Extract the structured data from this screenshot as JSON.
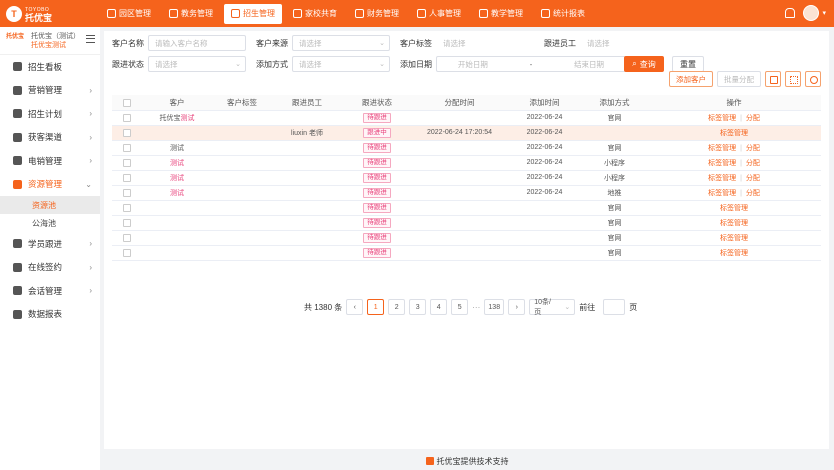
{
  "brand": {
    "en": "TOYOBO",
    "cn": "托优宝"
  },
  "nav": [
    {
      "label": "园区管理"
    },
    {
      "label": "教务管理"
    },
    {
      "label": "招生管理",
      "active": true
    },
    {
      "label": "家校共育"
    },
    {
      "label": "财务管理"
    },
    {
      "label": "人事管理"
    },
    {
      "label": "教学管理"
    },
    {
      "label": "统计报表"
    }
  ],
  "school": {
    "logo": "托优宝",
    "name": "托优宝（测试）",
    "sub": "托优宝测试"
  },
  "sidebar": [
    {
      "label": "招生看板",
      "arrow": ""
    },
    {
      "label": "营销管理",
      "arrow": "›"
    },
    {
      "label": "招生计划",
      "arrow": "›"
    },
    {
      "label": "获客渠道",
      "arrow": "›"
    },
    {
      "label": "电销管理",
      "arrow": "›"
    },
    {
      "label": "资源管理",
      "arrow": "⌄",
      "open": true
    },
    {
      "label": "学员跟进",
      "arrow": "›"
    },
    {
      "label": "在线签约",
      "arrow": "›"
    },
    {
      "label": "会话管理",
      "arrow": "›"
    },
    {
      "label": "数据报表",
      "arrow": ""
    }
  ],
  "submenu": [
    {
      "label": "资源池",
      "active": true
    },
    {
      "label": "公海池"
    }
  ],
  "filters": {
    "row1": [
      {
        "label": "客户名称",
        "placeholder": "请输入客户名称",
        "width": 0
      },
      {
        "label": "客户来源",
        "placeholder": "请选择"
      },
      {
        "label": "客户标签",
        "placeholder": "请选择"
      },
      {
        "label": "跟进员工",
        "placeholder": "请选择"
      }
    ],
    "row2": [
      {
        "label": "跟进状态",
        "placeholder": "请选择"
      },
      {
        "label": "添加方式",
        "placeholder": "请选择"
      },
      {
        "label": "添加日期",
        "start": "开始日期",
        "sep": "-",
        "end": "结束日期"
      }
    ],
    "search": "查询",
    "reset": "重置"
  },
  "toolbar": {
    "add": "添加客户",
    "batch": "批量分配"
  },
  "table": {
    "headers": [
      "",
      "客户",
      "客户标签",
      "跟进员工",
      "跟进状态",
      "分配时间",
      "添加时间",
      "添加方式",
      "操作"
    ],
    "rows": [
      {
        "customer": "托优宝",
        "customer_pink": "测试",
        "tag": "",
        "staff": "",
        "status": "待跟进",
        "assign": "",
        "added": "2022-06-24",
        "method": "官网",
        "op1": "标签管理",
        "op2": "分配"
      },
      {
        "customer": "",
        "customer_pink": "",
        "tag": "",
        "staff": "liuxin 老师",
        "status": "跟进中",
        "assign": "2022-06-24 17:20:54",
        "added": "2022-06-24",
        "method": "",
        "op1": "标签管理",
        "op2": "",
        "hl": true
      },
      {
        "customer": "测试",
        "customer_pink": "",
        "tag": "",
        "staff": "",
        "status": "待跟进",
        "assign": "",
        "added": "2022-06-24",
        "method": "官网",
        "op1": "标签管理",
        "op2": "分配"
      },
      {
        "customer": "",
        "customer_pink": "测试",
        "tag": "",
        "staff": "",
        "status": "待跟进",
        "assign": "",
        "added": "2022-06-24",
        "method": "小程序",
        "op1": "标签管理",
        "op2": "分配"
      },
      {
        "customer": "",
        "customer_pink": "测试",
        "tag": "",
        "staff": "",
        "status": "待跟进",
        "assign": "",
        "added": "2022-06-24",
        "method": "小程序",
        "op1": "标签管理",
        "op2": "分配"
      },
      {
        "customer": "",
        "customer_pink": "测试",
        "tag": "",
        "staff": "",
        "status": "待跟进",
        "assign": "",
        "added": "2022-06-24",
        "method": "地推",
        "op1": "标签管理",
        "op2": "分配"
      },
      {
        "customer": "",
        "customer_pink": "",
        "tag": "",
        "staff": "",
        "status": "待跟进",
        "assign": "",
        "added": "",
        "method": "官网",
        "op1": "标签管理",
        "op2": ""
      },
      {
        "customer": "",
        "customer_pink": "",
        "tag": "",
        "staff": "",
        "status": "待跟进",
        "assign": "",
        "added": "",
        "method": "官网",
        "op1": "标签管理",
        "op2": ""
      },
      {
        "customer": "",
        "customer_pink": "",
        "tag": "",
        "staff": "",
        "status": "待跟进",
        "assign": "",
        "added": "",
        "method": "官网",
        "op1": "标签管理",
        "op2": ""
      },
      {
        "customer": "",
        "customer_pink": "",
        "tag": "",
        "staff": "",
        "status": "待跟进",
        "assign": "",
        "added": "",
        "method": "官网",
        "op1": "标签管理",
        "op2": ""
      }
    ]
  },
  "pagination": {
    "total": "共 1380 条",
    "prev": "‹",
    "pages": [
      "1",
      "2",
      "3",
      "4",
      "5"
    ],
    "ellipsis": "···",
    "last": "138",
    "next": "›",
    "size": "10条/页",
    "goto": "前往",
    "page_unit": "页"
  },
  "footer": "托优宝提供技术支持"
}
